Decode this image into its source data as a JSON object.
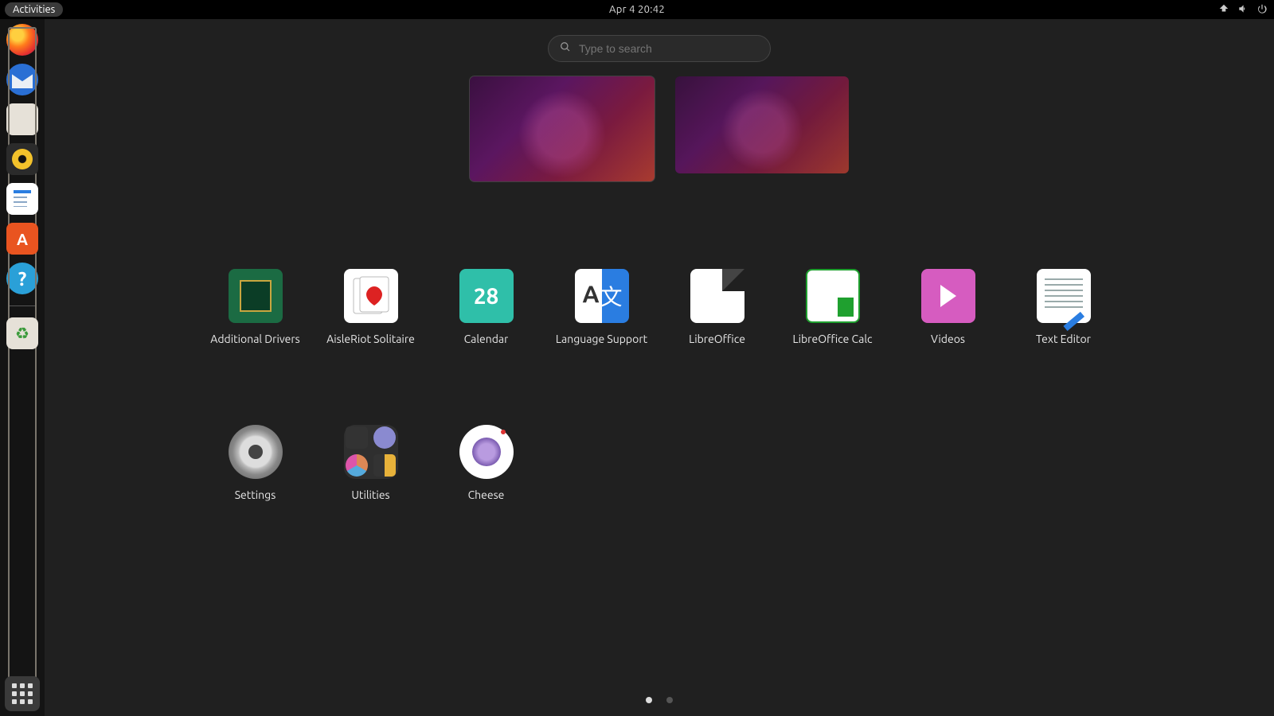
{
  "topbar": {
    "activities_label": "Activities",
    "clock": "Apr 4  20:42"
  },
  "search": {
    "placeholder": "Type to search"
  },
  "dock": {
    "items": [
      "Firefox",
      "Thunderbird",
      "Files",
      "Rhythmbox",
      "LibreOffice Writer",
      "Ubuntu Software",
      "Help"
    ],
    "trash": "Trash",
    "show_apps": "Show Applications"
  },
  "workspaces": {
    "count": 2,
    "active_index": 0
  },
  "apps": [
    {
      "label": "Additional Drivers",
      "icon": "drivers"
    },
    {
      "label": "AisleRiot Solitaire",
      "icon": "cards"
    },
    {
      "label": "Calendar",
      "icon": "calendar",
      "badge": "28"
    },
    {
      "label": "Language Support",
      "icon": "lang"
    },
    {
      "label": "LibreOffice",
      "icon": "lo"
    },
    {
      "label": "LibreOffice Calc",
      "icon": "calc"
    },
    {
      "label": "Videos",
      "icon": "videos"
    },
    {
      "label": "Text Editor",
      "icon": "text"
    },
    {
      "label": "Settings",
      "icon": "settings"
    },
    {
      "label": "Utilities",
      "icon": "utilities"
    },
    {
      "label": "Cheese",
      "icon": "cheese"
    }
  ],
  "pager": {
    "pages": 2,
    "active": 0
  }
}
